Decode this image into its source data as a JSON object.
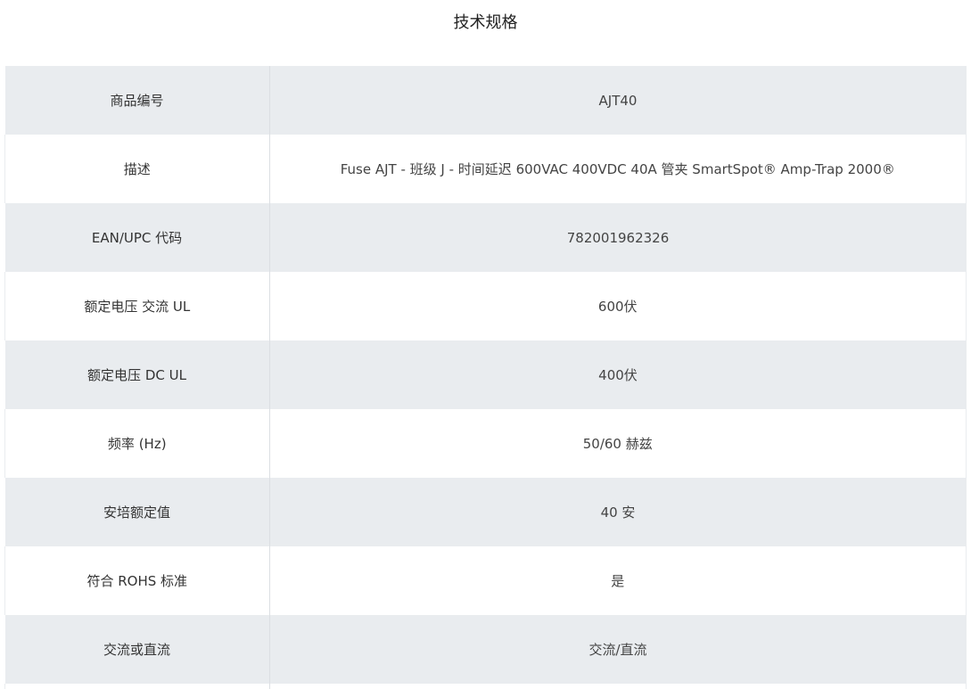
{
  "page": {
    "title": "技术规格"
  },
  "specs": [
    {
      "label": "商品编号",
      "value": "AJT40"
    },
    {
      "label": "描述",
      "value": "Fuse AJT - 班级 J - 时间延迟 600VAC 400VDC 40A 管夹 SmartSpot® Amp-Trap 2000®"
    },
    {
      "label": "EAN/UPC 代码",
      "value": "782001962326"
    },
    {
      "label": "额定电压 交流 UL",
      "value": "600伏"
    },
    {
      "label": "额定电压 DC UL",
      "value": "400伏"
    },
    {
      "label": "频率 (Hz)",
      "value": "50/60 赫兹"
    },
    {
      "label": "安培额定值",
      "value": "40 安"
    },
    {
      "label": "符合 ROHS 标准",
      "value": "是"
    },
    {
      "label": "交流或直流",
      "value": "交流/直流"
    }
  ]
}
